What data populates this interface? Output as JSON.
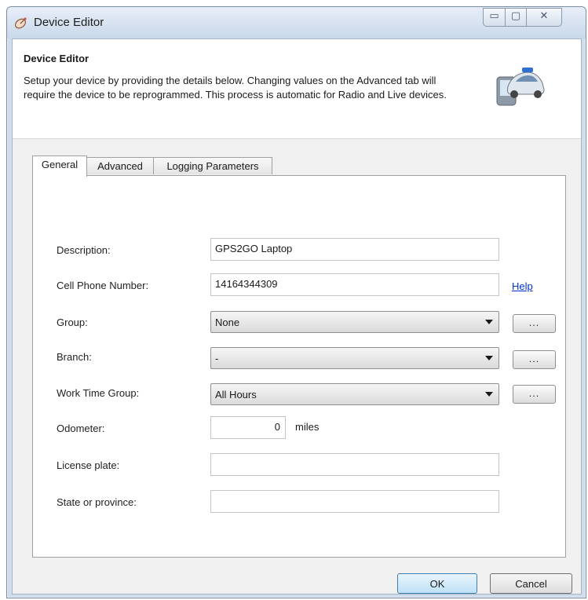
{
  "window": {
    "title": "Device Editor"
  },
  "header": {
    "title": "Device Editor",
    "description": "Setup your device by providing the details below. Changing values on the Advanced tab will require the device to be reprogrammed. This process is automatic for Radio and Live devices."
  },
  "tabs": [
    {
      "label": "General",
      "active": true
    },
    {
      "label": "Advanced",
      "active": false
    },
    {
      "label": "Logging Parameters",
      "active": false
    }
  ],
  "form": {
    "description_label": "Description:",
    "description_value": "GPS2GO Laptop",
    "phone_label": "Cell Phone Number:",
    "phone_value": "14164344309",
    "help_link": "Help",
    "group_label": "Group:",
    "group_value": "None",
    "branch_label": "Branch:",
    "branch_value": "-",
    "worktime_label": "Work Time Group:",
    "worktime_value": "All Hours",
    "odometer_label": "Odometer:",
    "odometer_value": "0",
    "odometer_units": "miles",
    "license_label": "License plate:",
    "license_value": "",
    "state_label": "State or province:",
    "state_value": "",
    "ellipsis": "..."
  },
  "buttons": {
    "ok": "OK",
    "cancel": "Cancel"
  },
  "window_controls": {
    "minimize": "▭",
    "maximize": "▢",
    "close": "✕"
  },
  "colors": {
    "link": "#0033cc",
    "ok_button": "#bfe1f7"
  }
}
